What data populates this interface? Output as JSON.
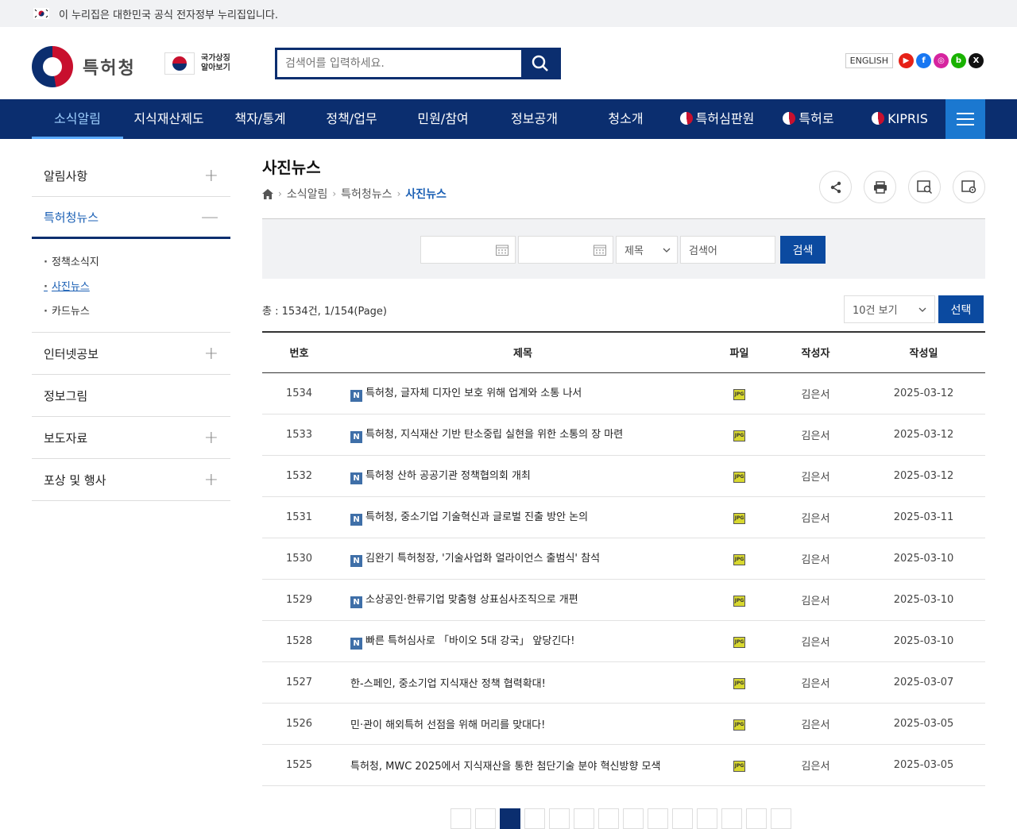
{
  "gov_banner": {
    "text": "이 누리집은 대한민국 공식 전자정부 누리집입니다."
  },
  "header": {
    "logo_text": "특허청",
    "nation_mark": [
      "국가상징",
      "알아보기"
    ],
    "search_placeholder": "검색어를 입력하세요.",
    "english_label": "ENGLISH",
    "sns": [
      {
        "name": "youtube",
        "color": "#e62117",
        "glyph": "▶"
      },
      {
        "name": "facebook",
        "color": "#1877f2",
        "glyph": "f"
      },
      {
        "name": "instagram",
        "color": "#d6249f",
        "glyph": "◎"
      },
      {
        "name": "blog",
        "color": "#19b200",
        "glyph": "b"
      },
      {
        "name": "x",
        "color": "#111111",
        "glyph": "X"
      }
    ]
  },
  "gnb": {
    "items": [
      "소식알림",
      "지식재산제도",
      "책자/통계",
      "정책/업무",
      "민원/참여",
      "정보공개",
      "청소개",
      "특허심판원",
      "특허로",
      "KIPRIS"
    ],
    "active": "소식알림"
  },
  "lnb": {
    "items": [
      {
        "label": "알림사항",
        "sign": "+"
      },
      {
        "label": "특허청뉴스",
        "sign": "—"
      },
      {
        "label": "인터넷공보",
        "sign": "+"
      },
      {
        "label": "정보그림",
        "sign": ""
      },
      {
        "label": "보도자료",
        "sign": "+"
      },
      {
        "label": "포상 및 행사",
        "sign": "+"
      }
    ],
    "sub_items": [
      "정책소식지",
      "사진뉴스",
      "카드뉴스"
    ],
    "current_sub": "사진뉴스"
  },
  "content": {
    "title": "사진뉴스",
    "breadcrumb": [
      "소식알림",
      "특허청뉴스",
      "사진뉴스"
    ]
  },
  "search_panel": {
    "select_value": "제목",
    "keyword_placeholder": "검색어",
    "button_label": "검색"
  },
  "list": {
    "total": "총 : 1534건, 1/154(Page)",
    "perpage": "10건 보기",
    "select_label": "선택",
    "columns": [
      "번호",
      "제목",
      "파일",
      "작성자",
      "작성일"
    ],
    "rows": [
      {
        "no": "1534",
        "new": true,
        "title": "특허청, 글자체 디자인 보호 위해 업계와 소통 나서",
        "author": "김은서",
        "date": "2025-03-12"
      },
      {
        "no": "1533",
        "new": true,
        "title": "특허청, 지식재산 기반 탄소중립 실현을 위한 소통의 장 마련",
        "author": "김은서",
        "date": "2025-03-12"
      },
      {
        "no": "1532",
        "new": true,
        "title": "특허청 산하 공공기관 정책협의회 개최",
        "author": "김은서",
        "date": "2025-03-12"
      },
      {
        "no": "1531",
        "new": true,
        "title": "특허청, 중소기업 기술혁신과 글로벌 진출 방안 논의",
        "author": "김은서",
        "date": "2025-03-11"
      },
      {
        "no": "1530",
        "new": true,
        "title": "김완기 특허청장, '기술사업화 얼라이언스 출범식' 참석",
        "author": "김은서",
        "date": "2025-03-10"
      },
      {
        "no": "1529",
        "new": true,
        "title": "소상공인·한류기업 맞춤형 상표심사조직으로 개편",
        "author": "김은서",
        "date": "2025-03-10"
      },
      {
        "no": "1528",
        "new": true,
        "title": "빠른 특허심사로 「바이오 5대 강국」 앞당긴다!",
        "author": "김은서",
        "date": "2025-03-10"
      },
      {
        "no": "1527",
        "new": false,
        "title": "한-스페인, 중소기업 지식재산 정책 협력확대!",
        "author": "김은서",
        "date": "2025-03-07"
      },
      {
        "no": "1526",
        "new": false,
        "title": "민·관이 해외특허 선점을 위해 머리를 맞대다!",
        "author": "김은서",
        "date": "2025-03-05"
      },
      {
        "no": "1525",
        "new": false,
        "title": "특허청, MWC 2025에서 지식재산을 통한 첨단기술 분야 혁신방향 모색",
        "author": "김은서",
        "date": "2025-03-05"
      }
    ],
    "new_badge": "N",
    "file_icon_label": "JPG"
  }
}
